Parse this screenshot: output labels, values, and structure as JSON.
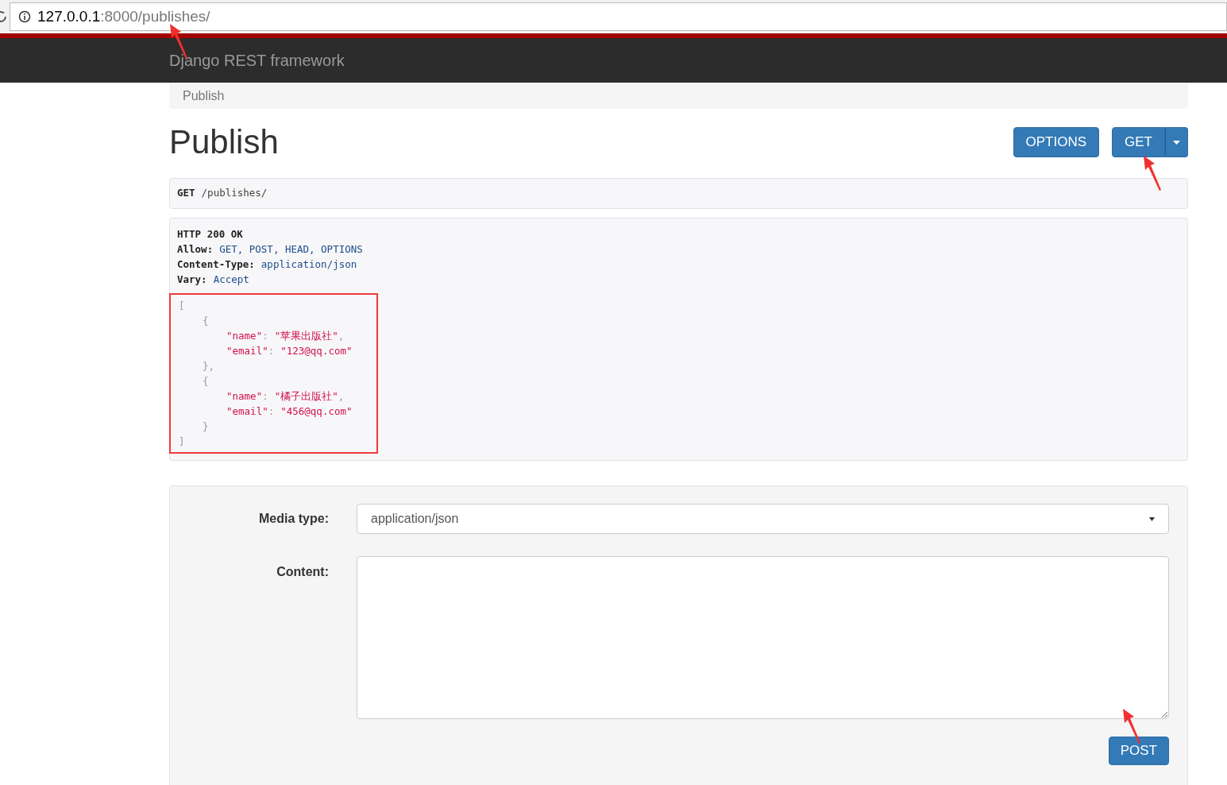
{
  "address_bar": {
    "host": "127.0.0.1",
    "path": ":8000/publishes/"
  },
  "navbar": {
    "brand": "Django REST framework"
  },
  "breadcrumb": [
    {
      "label": "Publish",
      "selected": true
    }
  ],
  "page": {
    "title": "Publish",
    "buttons": [
      {
        "label": "OPTIONS",
        "kind": "plain"
      },
      {
        "label": "GET",
        "kind": "split"
      }
    ]
  },
  "request": {
    "method": "GET",
    "path": "/publishes/"
  },
  "response": {
    "status": "HTTP 200 OK",
    "headers": [
      {
        "name": "Allow:",
        "value": "GET, POST, HEAD, OPTIONS"
      },
      {
        "name": "Content-Type:",
        "value": "application/json"
      },
      {
        "name": "Vary:",
        "value": "Accept"
      }
    ],
    "body": {
      "open": "[",
      "close": "]",
      "items": [
        {
          "open": "{",
          "close": "},",
          "fields": [
            {
              "key": "\"name\"",
              "colon": ":",
              "value": "\"苹果出版社\"",
              "comma": ","
            },
            {
              "key": "\"email\"",
              "colon": ":",
              "value": "\"123@qq.com\""
            }
          ]
        },
        {
          "open": "{",
          "close": "}",
          "fields": [
            {
              "key": "\"name\"",
              "colon": ":",
              "value": "\"橘子出版社\"",
              "comma": ","
            },
            {
              "key": "\"email\"",
              "colon": ":",
              "value": "\"456@qq.com\""
            }
          ]
        }
      ]
    }
  },
  "form": {
    "media_type": {
      "label": "Media type:",
      "value": "application/json"
    },
    "content": {
      "label": "Content:"
    },
    "submit": "POST"
  }
}
